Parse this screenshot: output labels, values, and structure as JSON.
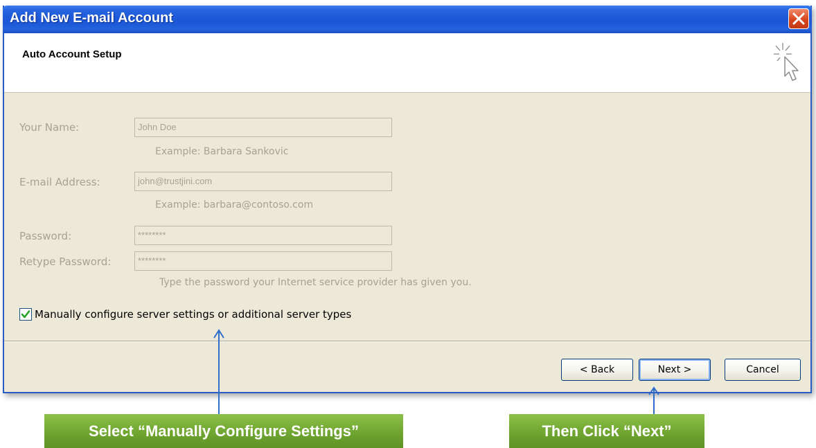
{
  "window": {
    "title": "Add New E-mail Account",
    "heading": "Auto Account Setup"
  },
  "form": {
    "name_label": "Your Name:",
    "name_value": "John Doe",
    "name_hint": "Example: Barbara Sankovic",
    "email_label": "E-mail Address:",
    "email_value": "john@trustjini.com",
    "email_hint": "Example: barbara@contoso.com",
    "password_label": "Password:",
    "password_value": "********",
    "retype_label": "Retype Password:",
    "retype_value": "********",
    "password_hint": "Type the password your Internet service provider has given you.",
    "manual_checkbox_label": "Manually configure server settings or additional server types",
    "manual_checkbox_checked": true
  },
  "buttons": {
    "back": "< Back",
    "next": "Next >",
    "cancel": "Cancel"
  },
  "annotations": {
    "left_callout": "Select “Manually Configure Settings”",
    "right_callout": "Then Click “Next”"
  },
  "colors": {
    "titlebar": "#2461db",
    "dialog_bg": "#ece9d8",
    "callout_green": "#6da32e",
    "arrow_blue": "#2f6fc9",
    "close_red": "#d8461f"
  },
  "icons": {
    "close": "close-icon",
    "wizard": "wizard-cursor-icon",
    "check": "checkmark-icon"
  }
}
